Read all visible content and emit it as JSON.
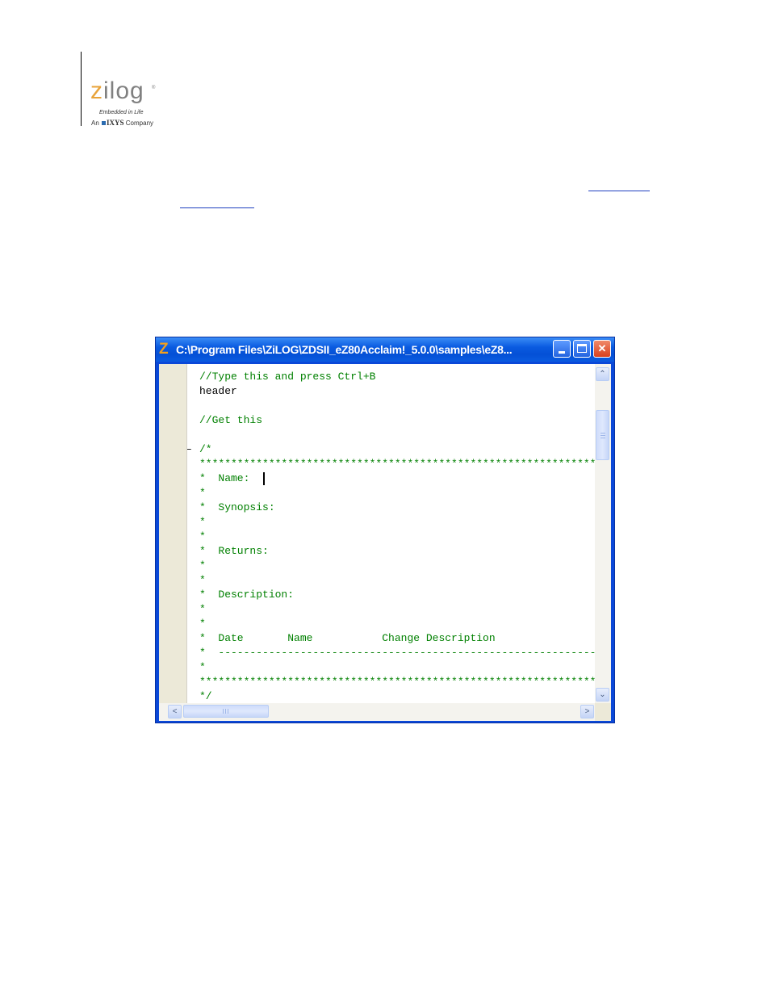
{
  "logo": {
    "z": "z",
    "rest": "ilog",
    "trademark": "®",
    "tagline": "Embedded in Life",
    "company_prefix": "An",
    "company_brand": "IXYS",
    "company_suffix": "Company"
  },
  "colors": {
    "logo_orange": "#e8a33a",
    "logo_gray": "#808080",
    "titlebar_blue": "#0a5be0",
    "comment_green": "#008000",
    "link_blue": "#1f3fbf"
  },
  "window": {
    "title": "C:\\Program Files\\ZiLOG\\ZDSII_eZ80Acclaim!_5.0.0\\samples\\eZ8...",
    "app_icon": "Z",
    "minimize_icon": "minimize-icon",
    "maximize_icon": "maximize-icon",
    "close_icon": "close-icon",
    "close_label": "✕"
  },
  "editor": {
    "fold_marker": "–",
    "lines": [
      {
        "text": "//Type this and press Ctrl+B",
        "style": "green"
      },
      {
        "text": "header",
        "style": "black"
      },
      {
        "text": "",
        "style": "black"
      },
      {
        "text": "//Get this",
        "style": "green"
      },
      {
        "text": "",
        "style": "black"
      },
      {
        "text": "/*",
        "style": "green"
      },
      {
        "text": "*****************************************************************",
        "style": "green"
      },
      {
        "text": "*  Name: ",
        "style": "green"
      },
      {
        "text": "*",
        "style": "green"
      },
      {
        "text": "*  Synopsis:",
        "style": "green"
      },
      {
        "text": "*",
        "style": "green"
      },
      {
        "text": "*",
        "style": "green"
      },
      {
        "text": "*  Returns:",
        "style": "green"
      },
      {
        "text": "*",
        "style": "green"
      },
      {
        "text": "*",
        "style": "green"
      },
      {
        "text": "*  Description:",
        "style": "green"
      },
      {
        "text": "*",
        "style": "green"
      },
      {
        "text": "*",
        "style": "green"
      },
      {
        "text": "*  Date       Name           Change Description",
        "style": "green"
      },
      {
        "text": "*  -------------------------------------------------------------",
        "style": "green"
      },
      {
        "text": "*",
        "style": "green"
      },
      {
        "text": "*****************************************************************",
        "style": "green"
      },
      {
        "text": "*/",
        "style": "green"
      }
    ]
  },
  "scrollbars": {
    "up_arrow": "⌃",
    "down_arrow": "⌄",
    "left_arrow": "<",
    "right_arrow": ">"
  }
}
